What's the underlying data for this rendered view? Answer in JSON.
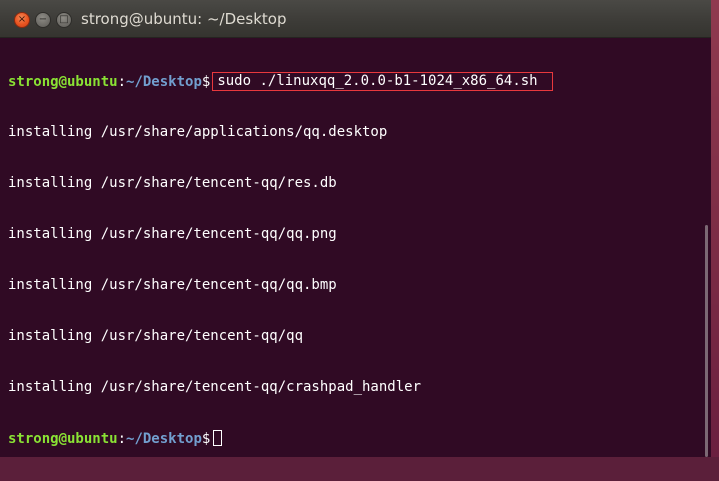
{
  "window": {
    "title": "strong@ubuntu: ~/Desktop",
    "close_glyph": "×",
    "minimize_glyph": "−",
    "maximize_glyph": "□"
  },
  "terminal": {
    "prompt": {
      "user_host": "strong@ubuntu",
      "colon": ":",
      "path": "~/Desktop",
      "dollar": "$"
    },
    "command": "sudo ./linuxqq_2.0.0-b1-1024_x86_64.sh",
    "output_lines": [
      "installing /usr/share/applications/qq.desktop",
      "installing /usr/share/tencent-qq/res.db",
      "installing /usr/share/tencent-qq/qq.png",
      "installing /usr/share/tencent-qq/qq.bmp",
      "installing /usr/share/tencent-qq/qq",
      "installing /usr/share/tencent-qq/crashpad_handler"
    ]
  },
  "colors": {
    "terminal_bg": "#300a24",
    "prompt_user": "#8ae234",
    "prompt_path": "#729fcf",
    "highlight_box": "#e8383d",
    "close_button": "#e95420"
  },
  "icons": {
    "close": "close-icon",
    "minimize": "minimize-icon",
    "maximize": "maximize-icon"
  }
}
